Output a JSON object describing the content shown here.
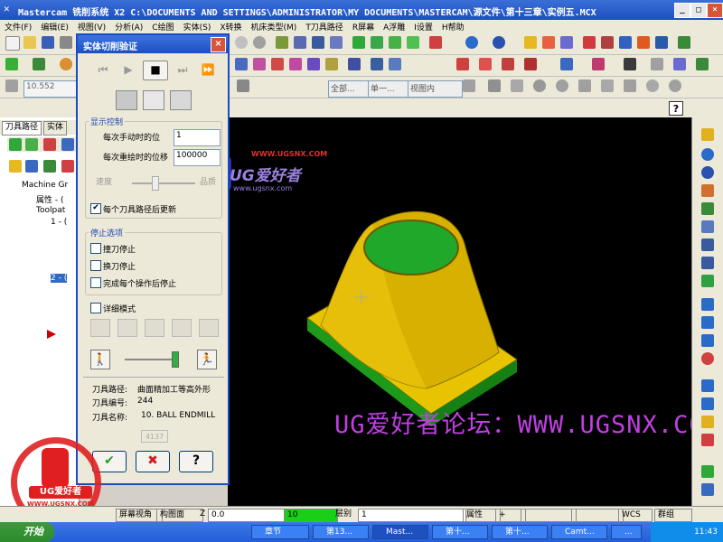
{
  "window": {
    "title": "Mastercam 铣削系统  X2  C:\\DOCUMENTS AND SETTINGS\\ADMINISTRATOR\\MY DOCUMENTS\\MASTERCAM\\源文件\\第十三章\\实例五.MCX",
    "controls": [
      "_",
      "□",
      "×"
    ]
  },
  "menu": [
    "文件(F)",
    "编辑(E)",
    "视图(V)",
    "分析(A)",
    "C绘图",
    "实体(S)",
    "X转换",
    "机床类型(M)",
    "T刀具路径",
    "R屏幕",
    "A浮雕",
    "I设置",
    "H帮助"
  ],
  "toolbar3": {
    "snap_value": "10.552",
    "all_label": "全部...",
    "single_label": "单一...",
    "view_label": "视图内"
  },
  "left_pane": {
    "tabs": [
      "刀具路径",
      "实体"
    ],
    "tree": [
      "Machine Gr",
      "属性 - (",
      "Toolpat",
      "1 - (",
      "2 - (",
      "-"
    ]
  },
  "dialog": {
    "title": "实体切削验证",
    "close": "×",
    "playback": [
      "⏮",
      "▶",
      "■",
      "⏭",
      "⏩"
    ],
    "display_group": "显示控制",
    "step_label": "每次手动时的位",
    "step_value": "1",
    "redraw_label": "每次重绘时的位移",
    "redraw_value": "100000",
    "speed_label": "速度",
    "quality_label": "品质",
    "update_each": "每个刀具路径后更新",
    "update_checked": "✔",
    "stop_group": "停止选项",
    "stop_collision": "撞刀停止",
    "stop_tool_change": "换刀停止",
    "stop_after_op": "完成每个操作后停止",
    "detail_mode": "详细模式",
    "info_path_label": "刀具路径:",
    "info_path_value": "曲面精加工等高外形",
    "info_num_label": "刀具编号:",
    "info_num_value": "244",
    "info_name_label": "刀具名称:",
    "info_name_value": "10. BALL ENDMILL",
    "disabled_btn": "4137",
    "ok": "✔",
    "cancel": "✖",
    "help": "?"
  },
  "watermark": {
    "forum_text": "UG爱好者论坛：WWW.UGSNX.COM",
    "logo_text": "UG爱好者",
    "logo_url": "WWW.UGSNX.COM",
    "small_url": "www.ugsnx.com",
    "badge_url": "WWW.UGSNX.COM",
    "corner_text": "UG爱好者",
    "corner_url": "WWW.UGSNX.COM"
  },
  "viewport": {
    "background": "#000000",
    "part_color": "#e8c400",
    "top_color": "#1fa82a",
    "base_color": "#1e9a1a"
  },
  "statusbar": {
    "screen_view": "屏幕视角",
    "plane": "构图面",
    "z_label": "Z",
    "z_value": "0.0",
    "color_value": "10",
    "layer_label": "层别",
    "layer_value": "1",
    "attr_label": "属性",
    "plus_label": "+",
    "wcs": "WCS",
    "group": "群组"
  },
  "taskbar": {
    "start": "开始",
    "tasks": [
      "章节",
      "第13...",
      "Mast...",
      "第十...",
      "第十...",
      "Camt...",
      "..."
    ],
    "clock": "11:43"
  },
  "help_icon": "?"
}
